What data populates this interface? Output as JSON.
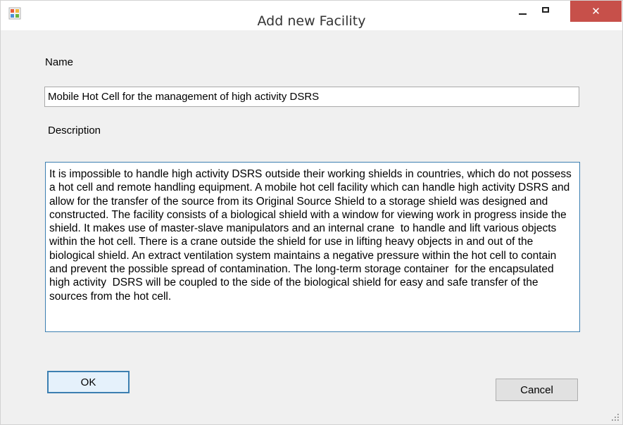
{
  "window": {
    "title": "Add new Facility",
    "icon": "app-form-icon",
    "controls": {
      "minimize_icon": "minimize-icon",
      "maximize_icon": "maximize-icon",
      "close_glyph": "✕"
    },
    "colors": {
      "close_button": "#c7504a",
      "focus_border": "#3c7fb1"
    }
  },
  "form": {
    "name_label": "Name",
    "name_value": "Mobile Hot Cell for the management of high activity DSRS",
    "description_label": "Description",
    "description_value": "It is impossible to handle high activity DSRS outside their working shields in countries, which do not possess a hot cell and remote handling equipment. A mobile hot cell facility which can handle high activity DSRS and allow for the transfer of the source from its Original Source Shield to a storage shield was designed and constructed. The facility consists of a biological shield with a window for viewing work in progress inside the shield. It makes use of master-slave manipulators and an internal crane  to handle and lift various objects within the hot cell. There is a crane outside the shield for use in lifting heavy objects in and out of the biological shield. An extract ventilation system maintains a negative pressure within the hot cell to contain and prevent the possible spread of contamination. The long-term storage container  for the encapsulated  high activity  DSRS will be coupled to the side of the biological shield for easy and safe transfer of the sources from the hot cell."
  },
  "buttons": {
    "ok_label": "OK",
    "cancel_label": "Cancel"
  }
}
